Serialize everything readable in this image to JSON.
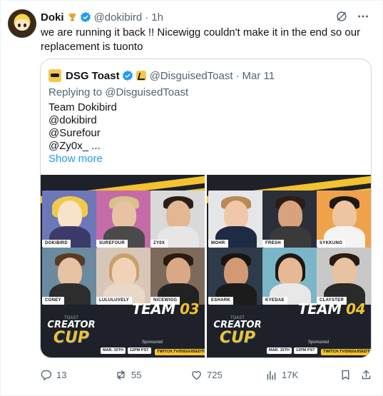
{
  "tweet": {
    "author_name": "Doki",
    "author_handle": "@dokibird",
    "separator": "·",
    "time": "1h",
    "text": "we are running it back !! Nicewigg couldn't make it in the end so our replacement is tuonto",
    "icons": [
      "trophy-icon",
      "verified-icon",
      "grok-icon",
      "more-icon"
    ],
    "verified_color": "#1d9bf0"
  },
  "quote": {
    "author_name": "DSG Toast",
    "author_handle": "@DisguisedToast",
    "separator": "·",
    "date": "Mar 11",
    "replying_to": "Replying to @DisguisedToast",
    "lines": [
      "Team Dokibird",
      "@dokibird",
      "@Surefour",
      "@Zy0x_ ..."
    ],
    "show_more": "Show more",
    "media": [
      {
        "team_word": "TEAM",
        "team_number": "03",
        "players": [
          "DOKIBIRD",
          "SUREFOUR",
          "ZY0X",
          "CONEY",
          "LULULUVELY",
          "NICEWIGG"
        ],
        "logo_top": "TOAST",
        "logo_creator": "CREATOR",
        "logo_cup": "CUP",
        "chips": [
          "MAR. 15TH",
          "12PM PST",
          "TWITCH.TV/DISGUISEDTOAST"
        ],
        "sponsor": "Sponsored"
      },
      {
        "team_word": "TEAM",
        "team_number": "04",
        "players": [
          "MOHR",
          "FRESH",
          "SYKKUNO",
          "ESHARK",
          "KYEDAE",
          "CLAYSTER"
        ],
        "logo_top": "TOAST",
        "logo_creator": "CREATOR",
        "logo_cup": "CUP",
        "chips": [
          "MAR. 15TH",
          "12PM PST",
          "TWITCH.TV/DISGUISEDTOAST"
        ],
        "sponsor": "Sponsored"
      }
    ]
  },
  "actions": {
    "replies": "13",
    "reposts": "55",
    "likes": "725",
    "views": "17K",
    "icons": [
      "reply-icon",
      "repost-icon",
      "like-icon",
      "views-icon",
      "bookmark-icon",
      "share-icon"
    ]
  },
  "colors": {
    "text": "#0f1419",
    "muted": "#536471",
    "link": "#1d9bf0",
    "border": "#cfd9de",
    "accent_yellow": "#f2c230",
    "media_dark": "#1e2129"
  }
}
